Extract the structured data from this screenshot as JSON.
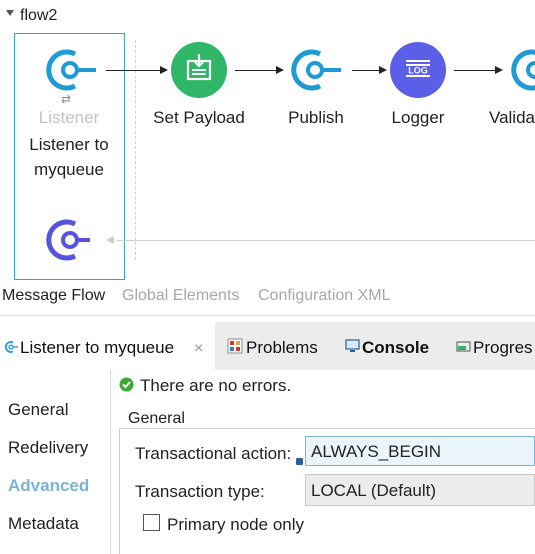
{
  "flow": {
    "name": "flow2",
    "source": {
      "top_label": "Listener",
      "name_line1": "Listener to",
      "name_line2": "myqueue",
      "swap_glyph": "⇄"
    },
    "processors": [
      {
        "label": "Set Payload",
        "icon": "set-payload-icon"
      },
      {
        "label": "Publish",
        "icon": "publish-icon"
      },
      {
        "label": "Logger",
        "icon": "logger-icon",
        "badge": "LOG"
      },
      {
        "label": "Valida",
        "icon": "validation-icon"
      }
    ]
  },
  "editor_tabs": [
    "Message Flow",
    "Global Elements",
    "Configuration XML"
  ],
  "properties": {
    "tabs": [
      {
        "label": "Listener to myqueue",
        "close": "×"
      },
      {
        "label": "Problems"
      },
      {
        "label": "Console"
      },
      {
        "label": "Progres"
      }
    ],
    "status": "There are no errors.",
    "nav": [
      "General",
      "Redelivery",
      "Advanced",
      "Metadata"
    ],
    "group_title": "General",
    "transactional_action_label": "Transactional action:",
    "transactional_action_value": "ALWAYS_BEGIN",
    "transaction_type_label": "Transaction type:",
    "transaction_type_value": "LOCAL (Default)",
    "primary_node_label": "Primary node only",
    "primary_node_checked": false
  },
  "colors": {
    "connector_blue": "#1e9bd7",
    "set_payload_green": "#2fb667",
    "logger_purple": "#5b5ee6",
    "source_purple": "#5553e0",
    "active_nav": "#7ab3d6",
    "selection_border": "#3aa0c8"
  }
}
